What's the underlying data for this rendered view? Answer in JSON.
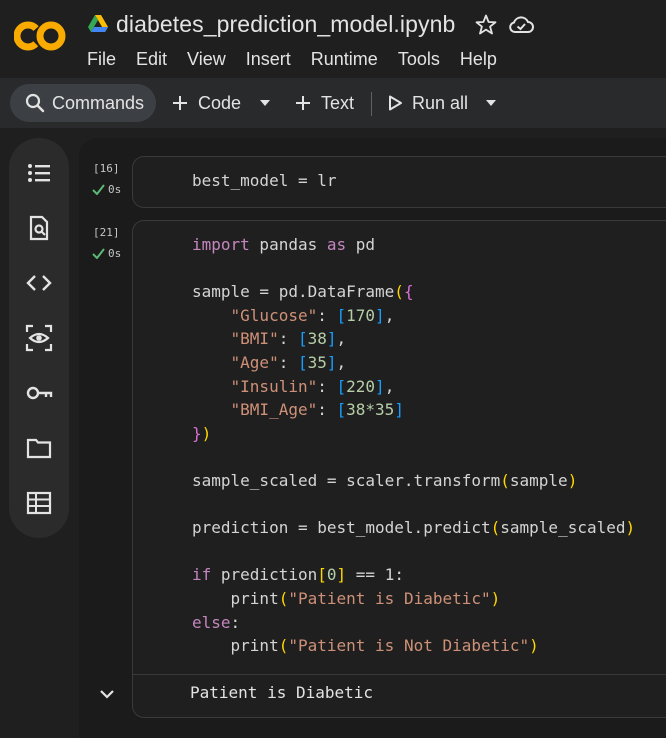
{
  "header": {
    "title": "diabetes_prediction_model.ipynb",
    "menu": [
      "File",
      "Edit",
      "View",
      "Insert",
      "Runtime",
      "Tools",
      "Help"
    ]
  },
  "toolbar": {
    "commands_label": "Commands",
    "code_label": "Code",
    "text_label": "Text",
    "run_all_label": "Run all"
  },
  "sidebar": {
    "icons": [
      "table-of-contents-icon",
      "find-icon",
      "code-snippets-icon",
      "variables-icon",
      "secrets-key-icon",
      "files-folder-icon",
      "data-table-icon"
    ]
  },
  "cells": [
    {
      "exec_count": "[16]",
      "status": "0s",
      "code": "best_model = lr"
    },
    {
      "exec_count": "[21]",
      "status": "0s",
      "output": "Patient is Diabetic"
    }
  ],
  "code_tokens": {
    "import": "import",
    "pandas": " pandas ",
    "as": "as",
    "pd": " pd",
    "sample_assign": "sample = pd.DataFrame",
    "glucose_key": "\"Glucose\"",
    "glucose_val": "170",
    "bmi_key": "\"BMI\"",
    "bmi_val": "38",
    "age_key": "\"Age\"",
    "age_val": "35",
    "insulin_key": "\"Insulin\"",
    "insulin_val": "220",
    "bmiage_key": "\"BMI_Age\"",
    "bmiage_val": "38*35",
    "scaled_line": "sample_scaled = scaler.transform",
    "scaled_arg": "sample",
    "pred_line": "prediction = best_model.predict",
    "pred_arg": "sample_scaled",
    "if": "if",
    "if_cond_a": " prediction",
    "if_idx": "0",
    "if_cond_b": " == 1:",
    "print": "print",
    "msg_yes": "\"Patient is Diabetic\"",
    "else": "else",
    "msg_no": "\"Patient is Not Diabetic\""
  }
}
